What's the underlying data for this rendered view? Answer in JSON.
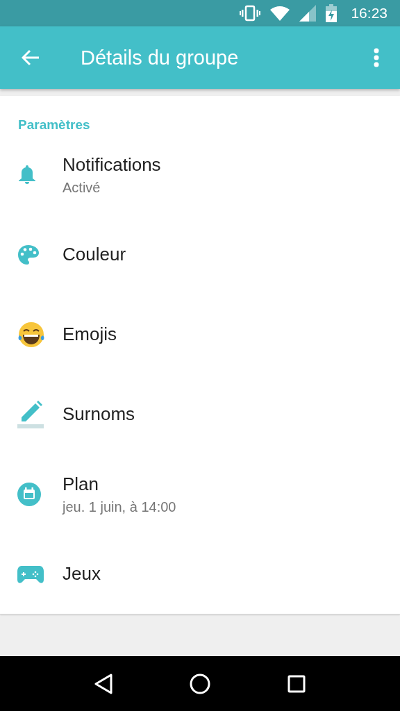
{
  "status_bar": {
    "time": "16:23"
  },
  "app_bar": {
    "title": "Détails du groupe"
  },
  "section": {
    "title": "Paramètres"
  },
  "items": [
    {
      "kind": "bell",
      "title": "Notifications",
      "subtitle": "Activé"
    },
    {
      "kind": "palette",
      "title": "Couleur"
    },
    {
      "kind": "emoji",
      "title": "Emojis"
    },
    {
      "kind": "pencil",
      "title": "Surnoms"
    },
    {
      "kind": "calendar",
      "title": "Plan",
      "subtitle": "jeu. 1 juin, à 14:00"
    },
    {
      "kind": "gamepad",
      "title": "Jeux"
    }
  ]
}
